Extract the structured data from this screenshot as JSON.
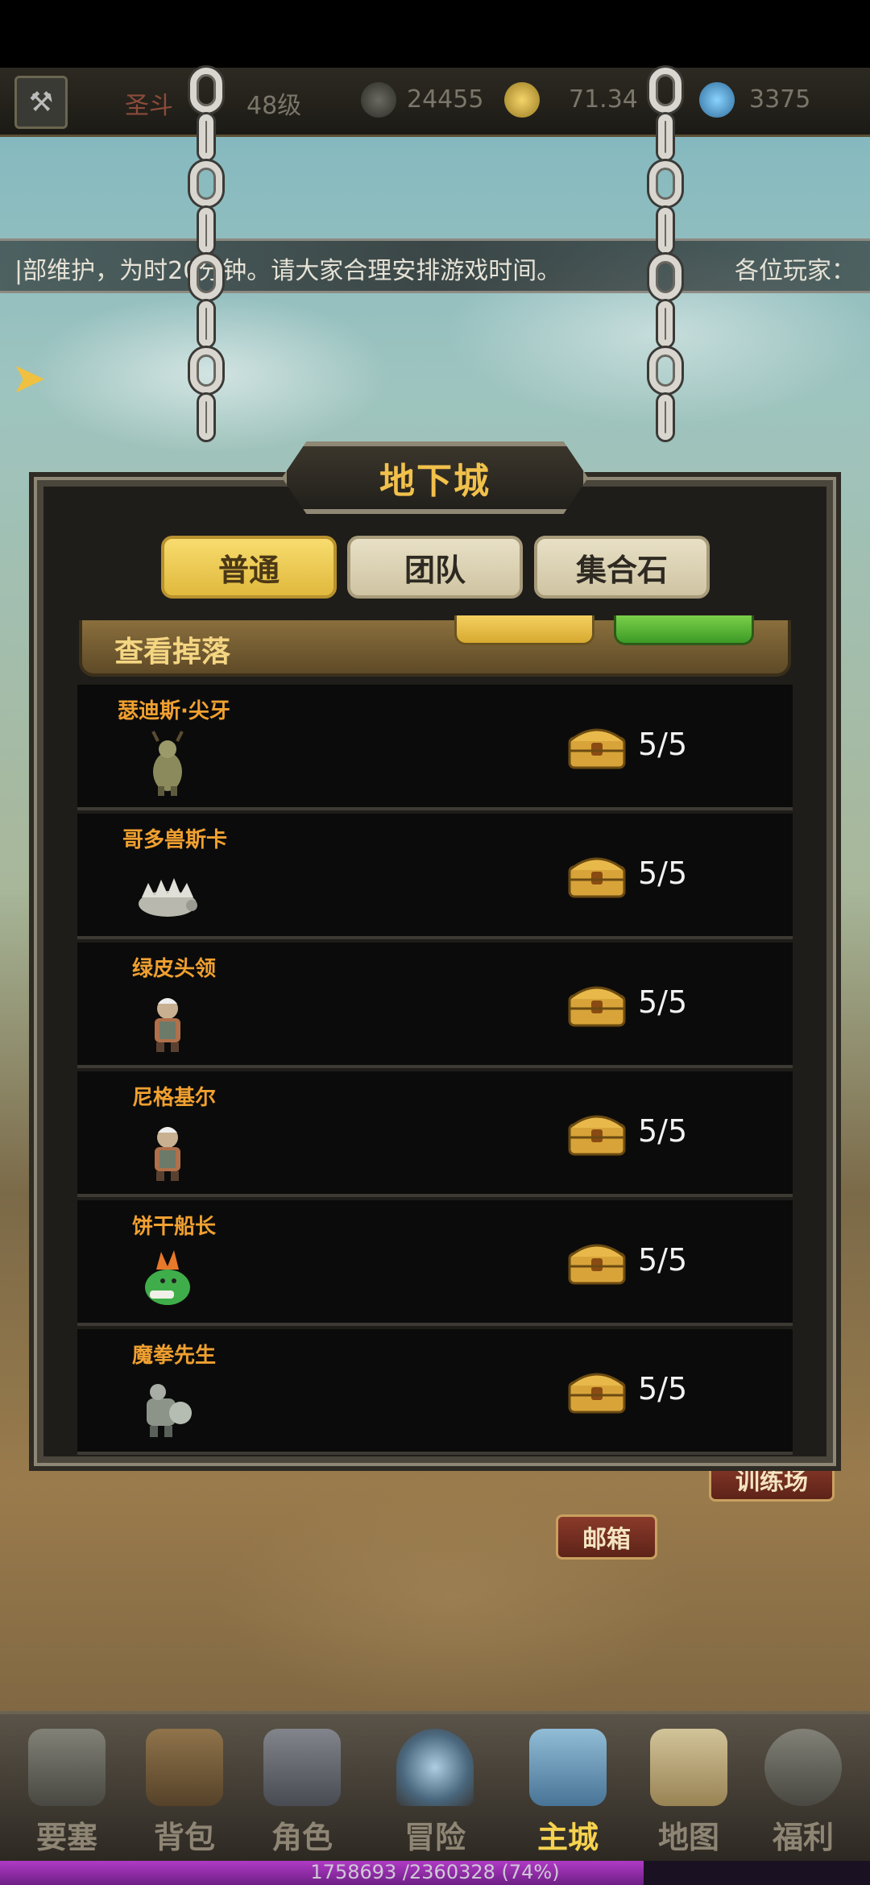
{
  "topbar": {
    "name": "圣斗",
    "level": "48级",
    "power": "24455",
    "gold": "71.34",
    "gems": "3375"
  },
  "marquee": {
    "left_text": "|部维护，为时20分钟。请大家合理安排游戏时间。",
    "right_text": "各位玩家："
  },
  "dialog": {
    "title": "地下城",
    "tabs": [
      {
        "label": "普通",
        "active": true
      },
      {
        "label": "团队",
        "active": false
      },
      {
        "label": "集合石",
        "active": false
      }
    ],
    "drop_header_label": "查看掉落",
    "rows": [
      {
        "name": "瑟迪斯·尖牙",
        "count": "5/5",
        "icon": "stag-warrior-icon"
      },
      {
        "name": "哥多兽斯卡",
        "count": "5/5",
        "icon": "spiked-beast-icon"
      },
      {
        "name": "绿皮头领",
        "count": "5/5",
        "icon": "orc-chief-icon"
      },
      {
        "name": "尼格基尔",
        "count": "5/5",
        "icon": "dwarf-icon"
      },
      {
        "name": "饼干船长",
        "count": "5/5",
        "icon": "green-captain-icon"
      },
      {
        "name": "魔拳先生",
        "count": "5/5",
        "icon": "mech-fist-icon"
      }
    ]
  },
  "signs": {
    "training": "训练场",
    "mailbox": "邮箱"
  },
  "nav": {
    "items": [
      {
        "label": "要塞",
        "icon": "fortress-icon",
        "active": false
      },
      {
        "label": "背包",
        "icon": "backpack-icon",
        "active": false
      },
      {
        "label": "角色",
        "icon": "helmet-icon",
        "active": false
      },
      {
        "label": "冒险",
        "icon": "portal-icon",
        "active": false
      },
      {
        "label": "主城",
        "icon": "castle-icon",
        "active": true
      },
      {
        "label": "地图",
        "icon": "scroll-map-icon",
        "active": false
      },
      {
        "label": "福利",
        "icon": "gift-icon",
        "active": false
      }
    ]
  },
  "xp": {
    "text": "1758693 /2360328 (74%)",
    "progress": 0.74
  },
  "colors": {
    "accent_gold": "#f2c14b",
    "name_orange": "#f0a030",
    "xp_purple": "#b03ac6"
  }
}
